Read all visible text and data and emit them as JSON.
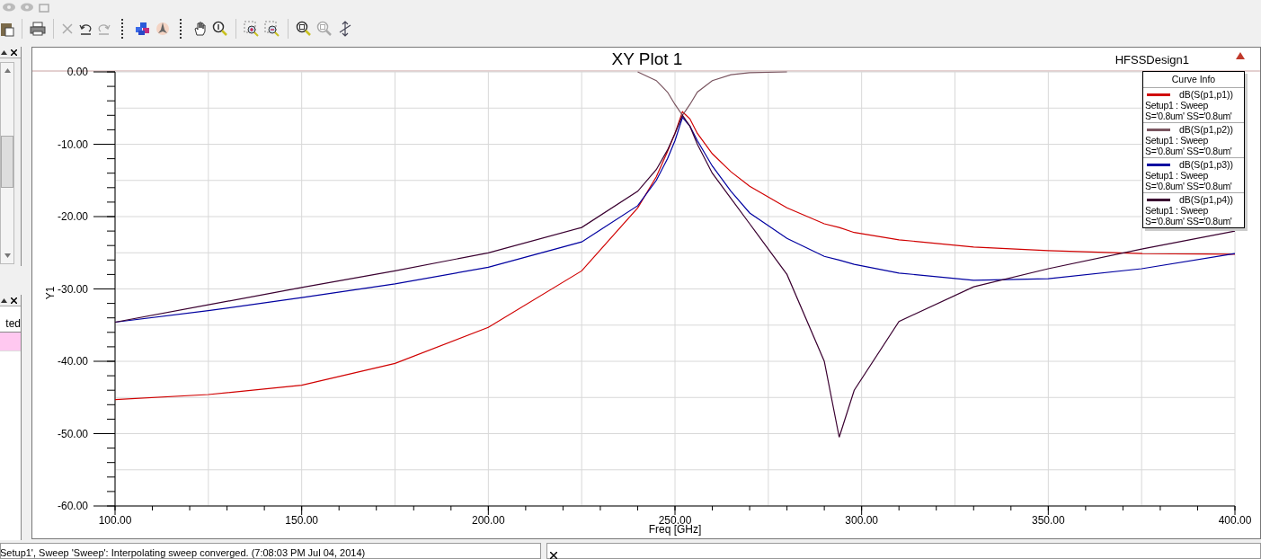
{
  "left_panel": {
    "column_header": "ted"
  },
  "plot": {
    "title": "XY Plot 1",
    "design": "HFSSDesign1",
    "legend": {
      "title": "Curve Info",
      "entries": [
        {
          "setup": "Setup1 : Sweep",
          "params": "S='0.8um' SS='0.8um'"
        },
        {
          "setup": "Setup1 : Sweep",
          "params": "S='0.8um' SS='0.8um'"
        },
        {
          "setup": "Setup1 : Sweep",
          "params": "S='0.8um' SS='0.8um'"
        },
        {
          "setup": "Setup1 : Sweep",
          "params": "S='0.8um' SS='0.8um'"
        }
      ]
    },
    "chart_data": {
      "type": "line",
      "xlabel": "Freq [GHz]",
      "ylabel": "Y1",
      "x": [
        100,
        125,
        150,
        175,
        200,
        225,
        240,
        245,
        248,
        250,
        252,
        254,
        256,
        260,
        265,
        270,
        280,
        290,
        294,
        298,
        310,
        330,
        350,
        375,
        400
      ],
      "series": [
        {
          "name": "dB(S(p1,p1))",
          "color": "#d00000",
          "values": [
            -45.3,
            -44.6,
            -43.3,
            -40.3,
            -35.3,
            -27.5,
            -18.8,
            -14.5,
            -11,
            -8.5,
            -5.5,
            -6.5,
            -8.5,
            -11.3,
            -13.8,
            -15.8,
            -18.8,
            -21,
            -21.5,
            -22.2,
            -23.2,
            -24.2,
            -24.7,
            -25.1,
            -25.2
          ]
        },
        {
          "name": "dB(S(p1,p2))",
          "color": "#7a5560",
          "values": [
            null,
            null,
            null,
            null,
            null,
            null,
            0,
            -1.2,
            -2.8,
            -4.5,
            -6,
            -4.5,
            -2.8,
            -1.2,
            -0.4,
            -0.1,
            0,
            null,
            null,
            null,
            null,
            null,
            null,
            null,
            null
          ]
        },
        {
          "name": "dB(S(p1,p3))",
          "color": "#0000a0",
          "values": [
            -34.6,
            -33,
            -31.2,
            -29.3,
            -27,
            -23.5,
            -18.5,
            -15,
            -12,
            -9.5,
            -6.3,
            -7.5,
            -9.5,
            -13,
            -16.5,
            -19.5,
            -23,
            -25.5,
            -26,
            -26.6,
            -27.8,
            -28.8,
            -28.6,
            -27.2,
            -25.1
          ]
        },
        {
          "name": "dB(S(p1,p4))",
          "color": "#3a0030",
          "values": [
            -34.6,
            -32.2,
            -29.8,
            -27.5,
            -25,
            -21.5,
            -16.5,
            -13.5,
            -10.8,
            -8.5,
            -6,
            -7.5,
            -10,
            -14,
            -17.5,
            -21,
            -28,
            -40,
            -50.5,
            -44,
            -34.5,
            -29.7,
            -27.2,
            -24.5,
            -22
          ]
        }
      ],
      "grid": true,
      "xlim": [
        100,
        400
      ],
      "ylim": [
        -60,
        0
      ],
      "xticks": [
        {
          "value": 100,
          "label": "100.00"
        },
        {
          "value": 150,
          "label": "150.00"
        },
        {
          "value": 200,
          "label": "200.00"
        },
        {
          "value": 250,
          "label": "250.00"
        },
        {
          "value": 300,
          "label": "300.00"
        },
        {
          "value": 350,
          "label": "350.00"
        },
        {
          "value": 400,
          "label": "400.00"
        }
      ],
      "yticks": [
        {
          "value": 0,
          "label": "0.00"
        },
        {
          "value": -10,
          "label": "-10.00"
        },
        {
          "value": -20,
          "label": "-20.00"
        },
        {
          "value": -30,
          "label": "-30.00"
        },
        {
          "value": -40,
          "label": "-40.00"
        },
        {
          "value": -50,
          "label": "-50.00"
        },
        {
          "value": -60,
          "label": "-60.00"
        }
      ]
    }
  },
  "status_bar": {
    "message": "Setup1', Sweep 'Sweep': Interpolating sweep converged. (7:08:03 PM  Jul 04, 2014)"
  }
}
